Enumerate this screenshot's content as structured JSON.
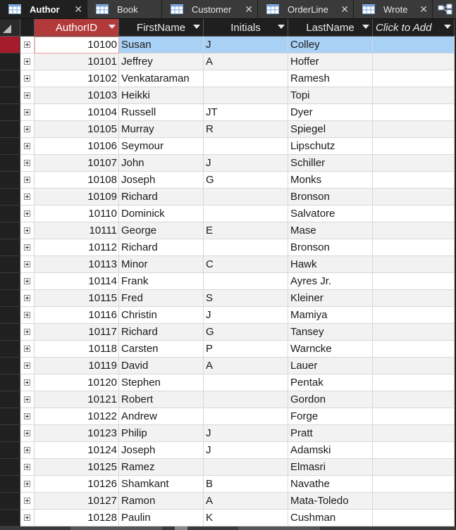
{
  "tabs": [
    {
      "label": "Author",
      "active": true
    },
    {
      "label": "Book",
      "active": false
    },
    {
      "label": "Customer",
      "active": false
    },
    {
      "label": "OrderLine",
      "active": false
    },
    {
      "label": "Wrote",
      "active": false
    }
  ],
  "colors": {
    "sorted_header": "#b33a3a",
    "current_row": "#a9d1f5",
    "record_selector_current": "#a51d2d"
  },
  "columns": [
    {
      "label": "AuthorID"
    },
    {
      "label": "FirstName"
    },
    {
      "label": "Initials"
    },
    {
      "label": "LastName"
    },
    {
      "label": "Click to Add"
    }
  ],
  "rows": [
    {
      "id": "10100",
      "first": "Susan",
      "init": "J",
      "last": "Colley"
    },
    {
      "id": "10101",
      "first": "Jeffrey",
      "init": "A",
      "last": "Hoffer"
    },
    {
      "id": "10102",
      "first": "Venkataraman",
      "init": "",
      "last": "Ramesh"
    },
    {
      "id": "10103",
      "first": "Heikki",
      "init": "",
      "last": "Topi"
    },
    {
      "id": "10104",
      "first": "Russell",
      "init": "JT",
      "last": "Dyer"
    },
    {
      "id": "10105",
      "first": "Murray",
      "init": "R",
      "last": "Spiegel"
    },
    {
      "id": "10106",
      "first": "Seymour",
      "init": "",
      "last": "Lipschutz"
    },
    {
      "id": "10107",
      "first": "John",
      "init": "J",
      "last": "Schiller"
    },
    {
      "id": "10108",
      "first": "Joseph",
      "init": "G",
      "last": "Monks"
    },
    {
      "id": "10109",
      "first": "Richard",
      "init": "",
      "last": "Bronson"
    },
    {
      "id": "10110",
      "first": "Dominick",
      "init": "",
      "last": "Salvatore"
    },
    {
      "id": "10111",
      "first": "George",
      "init": "E",
      "last": "Mase"
    },
    {
      "id": "10112",
      "first": "Richard",
      "init": "",
      "last": "Bronson"
    },
    {
      "id": "10113",
      "first": "Minor",
      "init": "C",
      "last": "Hawk"
    },
    {
      "id": "10114",
      "first": "Frank",
      "init": "",
      "last": "Ayres Jr."
    },
    {
      "id": "10115",
      "first": "Fred",
      "init": "S",
      "last": "Kleiner"
    },
    {
      "id": "10116",
      "first": "Christin",
      "init": "J",
      "last": "Mamiya"
    },
    {
      "id": "10117",
      "first": "Richard",
      "init": "G",
      "last": "Tansey"
    },
    {
      "id": "10118",
      "first": "Carsten",
      "init": "P",
      "last": "Warncke"
    },
    {
      "id": "10119",
      "first": "David",
      "init": "A",
      "last": "Lauer"
    },
    {
      "id": "10120",
      "first": "Stephen",
      "init": "",
      "last": "Pentak"
    },
    {
      "id": "10121",
      "first": "Robert",
      "init": "",
      "last": "Gordon"
    },
    {
      "id": "10122",
      "first": "Andrew",
      "init": "",
      "last": "Forge"
    },
    {
      "id": "10123",
      "first": "Philip",
      "init": "J",
      "last": "Pratt"
    },
    {
      "id": "10124",
      "first": "Joseph",
      "init": "J",
      "last": "Adamski"
    },
    {
      "id": "10125",
      "first": "Ramez",
      "init": "",
      "last": "Elmasri"
    },
    {
      "id": "10126",
      "first": "Shamkant",
      "init": "B",
      "last": "Navathe"
    },
    {
      "id": "10127",
      "first": "Ramon",
      "init": "A",
      "last": "Mata-Toledo"
    },
    {
      "id": "10128",
      "first": "Paulin",
      "init": "K",
      "last": "Cushman"
    }
  ]
}
